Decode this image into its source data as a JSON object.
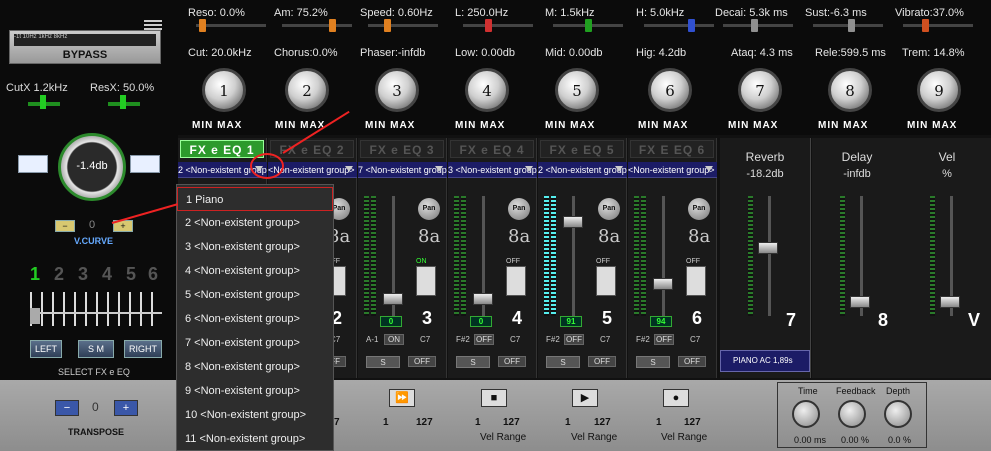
{
  "top_params": [
    {
      "label": "Reso: 0.0%",
      "thumb_color": "#e08020",
      "thumb_pos": 0.04
    },
    {
      "label": "Am: 75.2%",
      "thumb_color": "#e08020",
      "thumb_pos": 0.75
    },
    {
      "label": "Speed: 0.60Hz",
      "thumb_color": "#e08020",
      "thumb_pos": 0.25
    },
    {
      "label": "L: 250.0Hz",
      "thumb_color": "#d03030",
      "thumb_pos": 0.35
    },
    {
      "label": "M:   1.5kHz",
      "thumb_color": "#20a020",
      "thumb_pos": 0.5
    },
    {
      "label": "H:   5.0kHz",
      "thumb_color": "#3050d0",
      "thumb_pos": 0.7
    },
    {
      "label": "Decai: 5.3k ms",
      "thumb_color": "#909090",
      "thumb_pos": 0.45
    },
    {
      "label": "Sust:-6.3 ms",
      "thumb_color": "#909090",
      "thumb_pos": 0.55
    },
    {
      "label": "Vibrato:37.0%",
      "thumb_color": "#d05020",
      "thumb_pos": 0.3
    }
  ],
  "knob_labels": [
    {
      "label": "Cut: 20.0kHz",
      "num": "1"
    },
    {
      "label": "Chorus:0.0%",
      "num": "2"
    },
    {
      "label": "Phaser:-infdb",
      "num": "3"
    },
    {
      "label": "Low: 0.00db",
      "num": "4"
    },
    {
      "label": "Mid: 0.00db",
      "num": "5"
    },
    {
      "label": "Hig: 4.2db",
      "num": "6"
    },
    {
      "label": "Ataq: 4.3 ms",
      "num": "7"
    },
    {
      "label": "Rele:599.5 ms",
      "num": "8"
    },
    {
      "label": "Trem: 14.8%",
      "num": "9"
    }
  ],
  "minmax": {
    "min": "MIN",
    "max": "MAX"
  },
  "left": {
    "bypass": "BYPASS",
    "scale": "-1t      10Hz        1kHz       8kHz",
    "cutx": "CutX  1.2kHz",
    "resx": "ResX: 50.0%",
    "gain": "-1.4db",
    "vcurve": "V.CURVE",
    "vcurve_value": "0",
    "minus": "−",
    "plus": "+",
    "numbers": [
      "1",
      "2",
      "3",
      "4",
      "5",
      "6"
    ],
    "left_btn": "LEFT",
    "sm_btn": "S M",
    "right_btn": "RIGHT",
    "select_label": "SELECT  FX e EQ"
  },
  "strips": [
    {
      "head": "FX e EQ 1",
      "group": "2 <Non-existent group>",
      "active": true
    },
    {
      "head": "FX e EQ 2",
      "group": "<Non-existent group>",
      "active": false,
      "num": "2",
      "note": "C7",
      "octave": "8a",
      "pan": "Pan",
      "toggle": "OFF",
      "lcd": "0",
      "s": "S",
      "off": "OFF"
    },
    {
      "head": "FX e EQ 3",
      "group": "7 <Non-existent group>",
      "active": false,
      "num": "3",
      "note_l": "A-1",
      "note": "C7",
      "octave": "8a",
      "pan": "Pan",
      "toggle": "ON",
      "lcd": "0",
      "s": "S",
      "off": "OFF"
    },
    {
      "head": "FX e EQ 4",
      "group": "3 <Non-existent group>",
      "active": false,
      "num": "4",
      "note_l": "F#2",
      "note": "C7",
      "octave": "8a",
      "pan": "Pan",
      "toggle": "OFF",
      "lcd": "0",
      "s": "S",
      "off": "OFF"
    },
    {
      "head": "FX e EQ 5",
      "group": "2 <Non-existent group>",
      "active": false,
      "num": "5",
      "note_l": "F#2",
      "note": "C7",
      "octave": "8a",
      "pan": "Pan",
      "toggle": "OFF",
      "lcd": "91",
      "s": "S",
      "off": "OFF"
    },
    {
      "head": "FX E EQ 6",
      "group": "<Non-existent group>",
      "active": false,
      "num": "6",
      "note_l": "F#2",
      "note": "C7",
      "octave": "8a",
      "pan": "Pan",
      "toggle": "OFF",
      "lcd": "94",
      "s": "S",
      "off": "OFF"
    }
  ],
  "fx_cols": [
    {
      "title": "Reverb",
      "value": "-18.2db",
      "num": "7",
      "preset": "PIANO AC 1,89s"
    },
    {
      "title": "Delay",
      "value": "-infdb",
      "num": "8"
    },
    {
      "title": "Vel",
      "value": "%",
      "num": "V"
    }
  ],
  "dropdown": {
    "items": [
      "1 Piano",
      "2 <Non-existent group>",
      "3 <Non-existent group>",
      "4 <Non-existent group>",
      "5 <Non-existent group>",
      "6 <Non-existent group>",
      "7 <Non-existent group>",
      "8 <Non-existent group>",
      "9 <Non-existent group>",
      "10 <Non-existent group>",
      "11 <Non-existent group>"
    ],
    "selected_index": 0
  },
  "bottom": {
    "transpose": "TRANSPOSE",
    "transpose_value": "0",
    "vel_ranges": [
      {
        "lo": "1",
        "hi": "127",
        "label": "Vel Range",
        "icon": "fast-forward"
      },
      {
        "lo": "1",
        "hi": "127",
        "label": "Vel Range",
        "icon": "stop"
      },
      {
        "lo": "1",
        "hi": "127",
        "label": "Vel Range",
        "icon": "play"
      }
    ],
    "time_label": "Time",
    "time_value": "0.00 ms",
    "feedback_label": "Feedback",
    "feedback_value": "0.00 %",
    "depth_label": "Depth",
    "depth_value": "0.0 %",
    "partial_7": "7"
  }
}
